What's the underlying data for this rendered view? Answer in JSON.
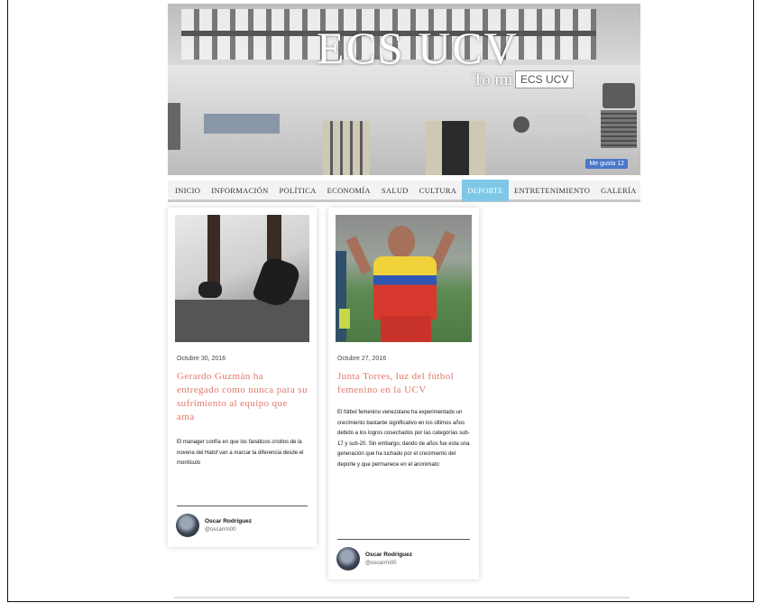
{
  "header": {
    "title": "ECS UCV",
    "subtitle": "To mi",
    "subtitle_badge": "ECS UCV",
    "fb_badge": "Me gusta 12"
  },
  "nav": {
    "items": [
      {
        "label": "INICIO"
      },
      {
        "label": "INFORMACIÓN"
      },
      {
        "label": "POLÍTICA"
      },
      {
        "label": "ECONOMÍA"
      },
      {
        "label": "SALUD"
      },
      {
        "label": "CULTURA"
      },
      {
        "label": "DEPORTE",
        "active": true
      },
      {
        "label": "ENTRETENIMIENTO"
      },
      {
        "label": "GALERÍA"
      }
    ],
    "active_color": "#7ec8e6"
  },
  "posts": [
    {
      "date": "Octubre 30, 2016",
      "title": "Gerardo Guzmán ha entregado como nunca para su sufrimiento al equipo que ama",
      "excerpt": "El manager confía en que los fanáticos criollos de la novena del Hatof van a marcar la diferencia desde el montículo",
      "author": "Oscar Rodríguez",
      "handle": "@oscarrm00",
      "image": "treadmill-runner-photo"
    },
    {
      "date": "Octubre 27, 2016",
      "title": "Junta Torres, luz del fútbol femenino en la UCV",
      "excerpt": "El fútbol femenino venezolano ha experimentado un crecimiento bastante significativo en los últimos años debido a los logros cosechados por las categorías sub-17 y sub-20. Sin embargo, dando de años fue esta una generación que ha luchado por el crecimiento del deporte y que permanece en el anonimato",
      "author": "Oscar Rodríguez",
      "handle": "@oscarrm00",
      "image": "football-player-photo"
    }
  ],
  "colors": {
    "title_accent": "#e2796a",
    "fb_blue": "#4a77c9"
  }
}
